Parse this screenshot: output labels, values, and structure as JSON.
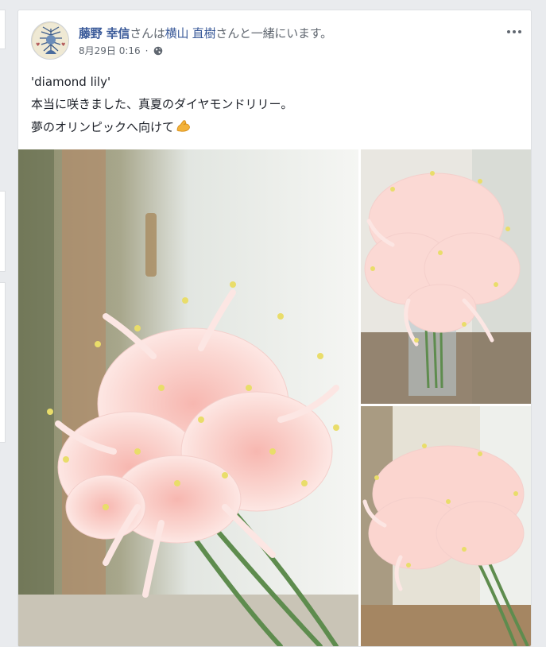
{
  "post": {
    "author": "藤野 幸信",
    "mid_text": "さんは",
    "tagged": "横山 直樹",
    "suffix": "さんと一緒にいます。",
    "timestamp": "8月29日 0:16",
    "privacy_icon": "globe-icon",
    "more_icon": "more-options-icon",
    "lines": [
      "'diamond lily'",
      "本当に咲きました、真夏のダイヤモンドリリー。",
      "夢のオリンピックへ向けて"
    ],
    "emoji": "flexed-biceps-emoji"
  },
  "photos": [
    {
      "description_icon": "pink-nerine-lily-photo-large"
    },
    {
      "description_icon": "pink-nerine-lily-in-vase-photo"
    },
    {
      "description_icon": "pink-nerine-lily-closeup-photo"
    }
  ],
  "colors": {
    "link": "#385898",
    "text": "#1d2129",
    "secondary": "#606770",
    "background": "#e9ebee"
  }
}
